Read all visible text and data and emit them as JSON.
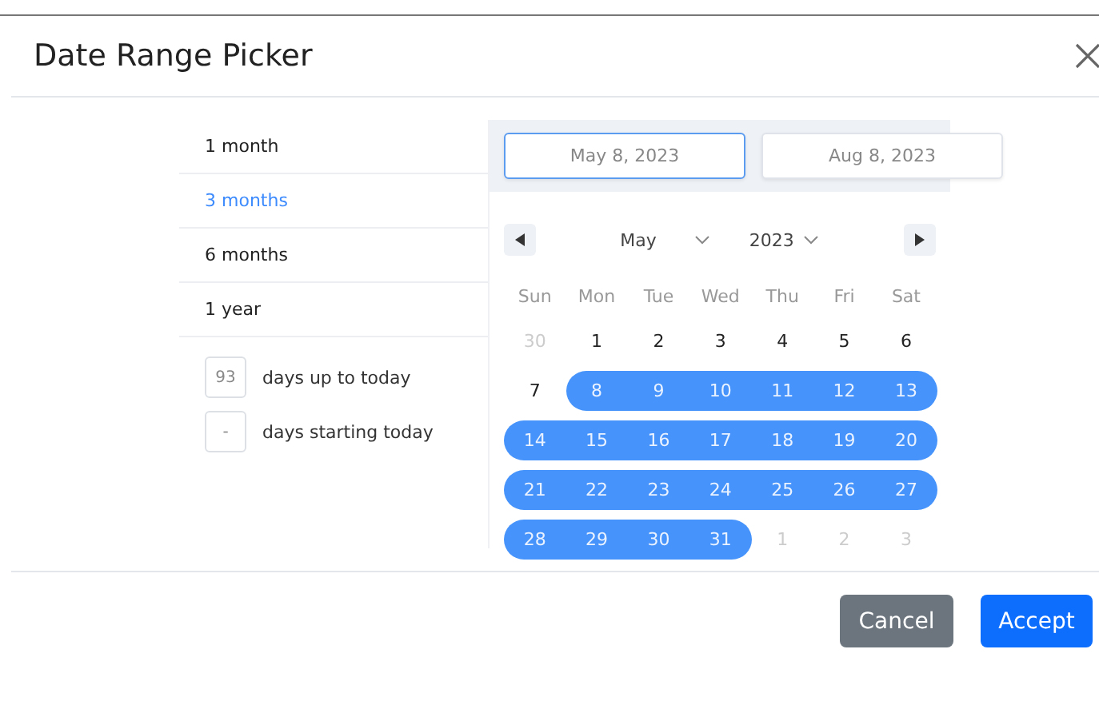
{
  "dialog": {
    "title": "Date Range Picker"
  },
  "presets": [
    {
      "label": "1 month",
      "selected": false
    },
    {
      "label": "3 months",
      "selected": true
    },
    {
      "label": "6 months",
      "selected": false
    },
    {
      "label": "1 year",
      "selected": false
    }
  ],
  "day_counts": [
    {
      "value": "93",
      "label": "days up to today"
    },
    {
      "value": "-",
      "label": "days starting today"
    }
  ],
  "range_fields": [
    {
      "value": "May 8, 2023",
      "focused": true
    },
    {
      "value": "Aug 8, 2023",
      "focused": false
    }
  ],
  "calendar": {
    "month": "May",
    "year": "2023",
    "weekdays": [
      "Sun",
      "Mon",
      "Tue",
      "Wed",
      "Thu",
      "Fri",
      "Sat"
    ],
    "days": [
      {
        "label": "30",
        "outside": true,
        "in_range": false
      },
      {
        "label": "1",
        "outside": false,
        "in_range": false
      },
      {
        "label": "2",
        "outside": false,
        "in_range": false
      },
      {
        "label": "3",
        "outside": false,
        "in_range": false
      },
      {
        "label": "4",
        "outside": false,
        "in_range": false
      },
      {
        "label": "5",
        "outside": false,
        "in_range": false
      },
      {
        "label": "6",
        "outside": false,
        "in_range": false
      },
      {
        "label": "7",
        "outside": false,
        "in_range": false
      },
      {
        "label": "8",
        "outside": false,
        "in_range": true
      },
      {
        "label": "9",
        "outside": false,
        "in_range": true
      },
      {
        "label": "10",
        "outside": false,
        "in_range": true
      },
      {
        "label": "11",
        "outside": false,
        "in_range": true
      },
      {
        "label": "12",
        "outside": false,
        "in_range": true
      },
      {
        "label": "13",
        "outside": false,
        "in_range": true
      },
      {
        "label": "14",
        "outside": false,
        "in_range": true
      },
      {
        "label": "15",
        "outside": false,
        "in_range": true
      },
      {
        "label": "16",
        "outside": false,
        "in_range": true
      },
      {
        "label": "17",
        "outside": false,
        "in_range": true
      },
      {
        "label": "18",
        "outside": false,
        "in_range": true
      },
      {
        "label": "19",
        "outside": false,
        "in_range": true
      },
      {
        "label": "20",
        "outside": false,
        "in_range": true
      },
      {
        "label": "21",
        "outside": false,
        "in_range": true
      },
      {
        "label": "22",
        "outside": false,
        "in_range": true
      },
      {
        "label": "23",
        "outside": false,
        "in_range": true
      },
      {
        "label": "24",
        "outside": false,
        "in_range": true
      },
      {
        "label": "25",
        "outside": false,
        "in_range": true
      },
      {
        "label": "26",
        "outside": false,
        "in_range": true
      },
      {
        "label": "27",
        "outside": false,
        "in_range": true
      },
      {
        "label": "28",
        "outside": false,
        "in_range": true
      },
      {
        "label": "29",
        "outside": false,
        "in_range": true
      },
      {
        "label": "30",
        "outside": false,
        "in_range": true
      },
      {
        "label": "31",
        "outside": false,
        "in_range": true
      },
      {
        "label": "1",
        "outside": true,
        "in_range": false
      },
      {
        "label": "2",
        "outside": true,
        "in_range": false
      },
      {
        "label": "3",
        "outside": true,
        "in_range": false
      }
    ]
  },
  "buttons": [
    {
      "label": "Cancel",
      "kind": "secondary"
    },
    {
      "label": "Accept",
      "kind": "primary"
    }
  ]
}
